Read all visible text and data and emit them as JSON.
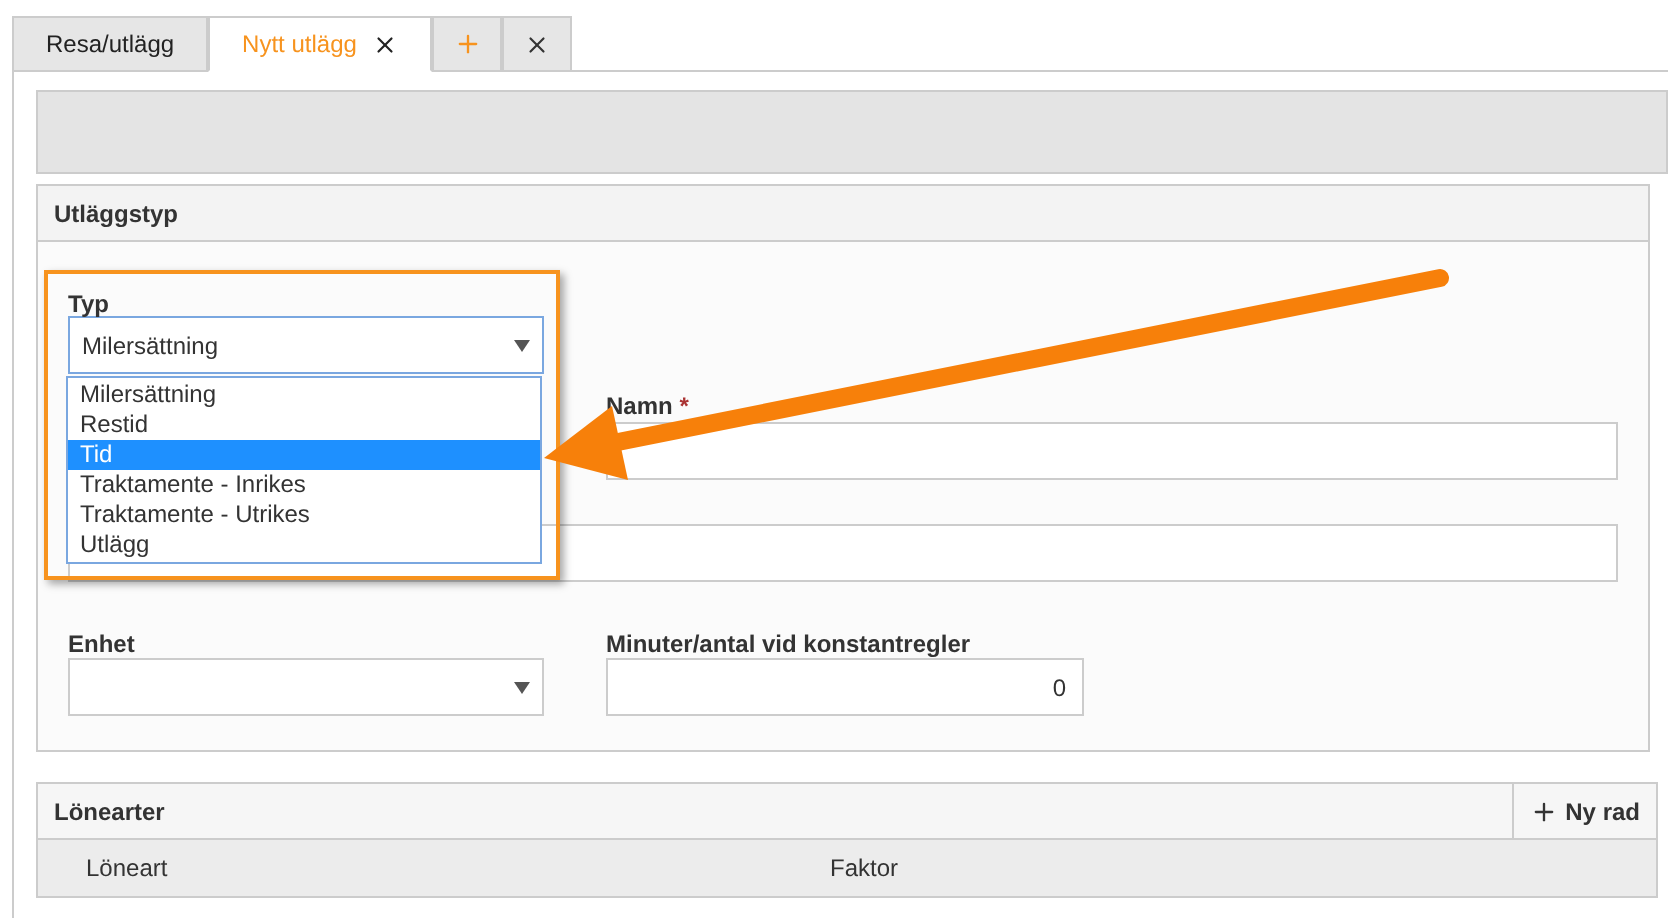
{
  "tabs": [
    {
      "label": "Resa/utlägg",
      "selected": false,
      "closable": false
    },
    {
      "label": "Nytt utlägg",
      "selected": true,
      "closable": true
    }
  ],
  "panel": {
    "title": "Utläggstyp",
    "typ": {
      "label": "Typ",
      "value": "Milersättning",
      "expanded": true,
      "options": [
        {
          "label": "Milersättning",
          "highlighted": false
        },
        {
          "label": "Restid",
          "highlighted": false
        },
        {
          "label": "Tid",
          "highlighted": true
        },
        {
          "label": "Traktamente - Inrikes",
          "highlighted": false
        },
        {
          "label": "Traktamente - Utrikes",
          "highlighted": false
        },
        {
          "label": "Utlägg",
          "highlighted": false
        }
      ]
    },
    "namn": {
      "label": "Namn",
      "required_mark": "*"
    },
    "enhet": {
      "label": "Enhet"
    },
    "minuter": {
      "label": "Minuter/antal vid konstantregler",
      "value": "0"
    }
  },
  "lonearter": {
    "title": "Lönearter",
    "add_button": "Ny rad",
    "columns": [
      "Löneart",
      "Faktor"
    ]
  }
}
